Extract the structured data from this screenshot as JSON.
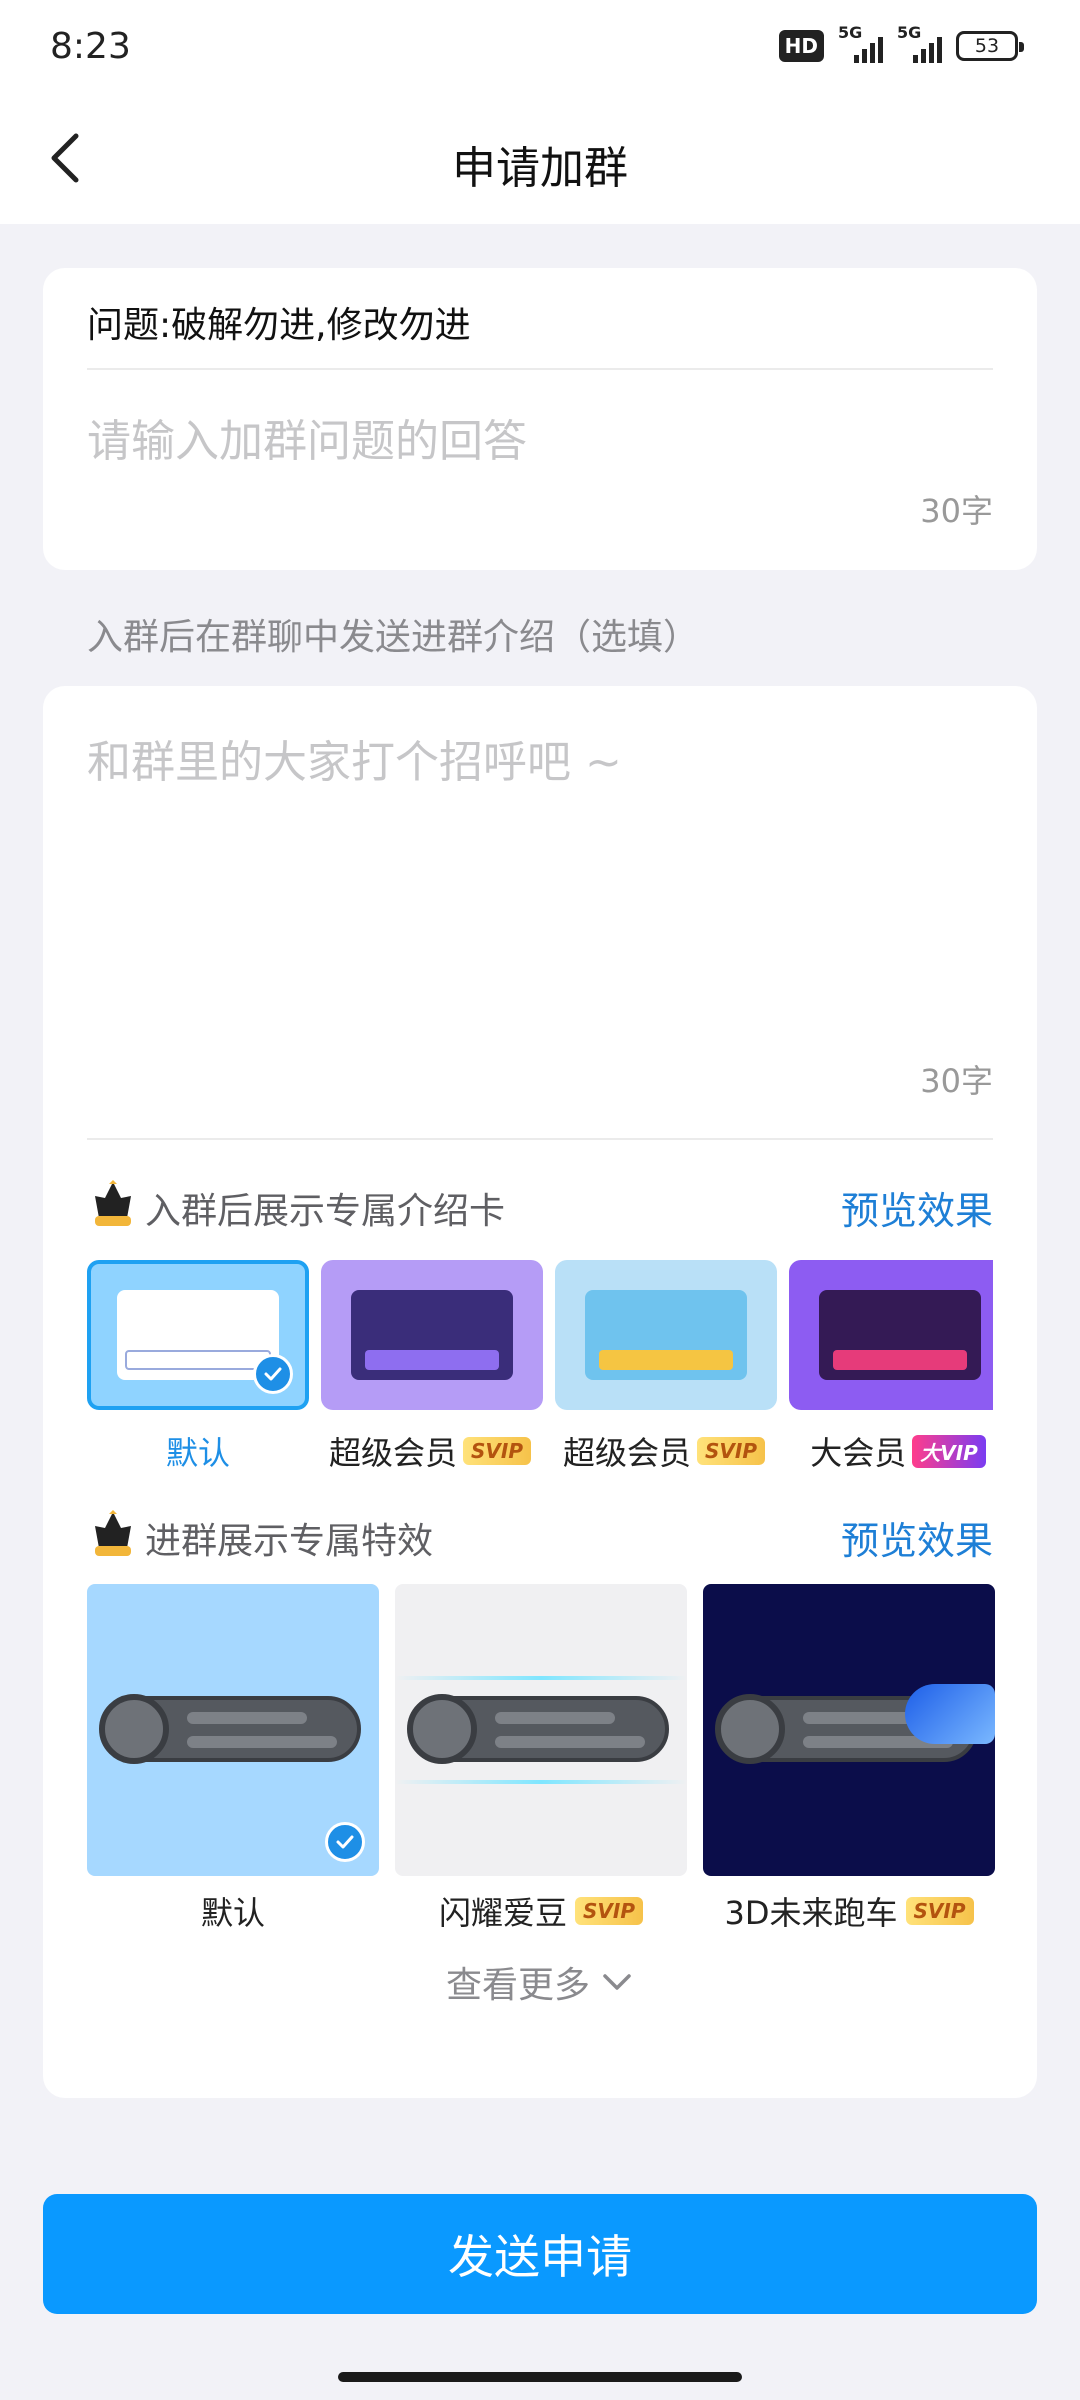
{
  "status_bar": {
    "time": "8:23",
    "network_badge": "HD",
    "signal_1_label": "5G",
    "signal_2_label": "5G",
    "battery": "53"
  },
  "nav": {
    "title": "申请加群"
  },
  "question_card": {
    "question": "问题:破解勿进,修改勿进",
    "answer_placeholder": "请输入加群问题的回答",
    "answer_value": "",
    "char_limit": "30字"
  },
  "intro_section": {
    "label": "入群后在群聊中发送进群介绍（选填）",
    "placeholder": "和群里的大家打个招呼吧 ~",
    "char_limit": "30字"
  },
  "intro_cards": {
    "title": "入群后展示专属介绍卡",
    "preview_label": "预览效果",
    "items": [
      {
        "label": "默认",
        "tag": "",
        "selected": true
      },
      {
        "label": "超级会员",
        "tag": "SVIP",
        "selected": false
      },
      {
        "label": "超级会员",
        "tag": "SVIP",
        "selected": false
      },
      {
        "label": "大会员",
        "tag": "大VIP",
        "selected": false
      }
    ]
  },
  "join_effects": {
    "title": "进群展示专属特效",
    "preview_label": "预览效果",
    "items": [
      {
        "label": "默认",
        "tag": "",
        "selected": true
      },
      {
        "label": "闪耀爱豆",
        "tag": "SVIP",
        "selected": false
      },
      {
        "label": "3D未来跑车",
        "tag": "SVIP",
        "selected": false
      }
    ],
    "more_label": "查看更多"
  },
  "submit": {
    "label": "发送申请"
  },
  "colors": {
    "accent": "#0a99ff",
    "link": "#1e7fd6",
    "background": "#f2f2f7",
    "selected_border": "#1ea1f2"
  }
}
